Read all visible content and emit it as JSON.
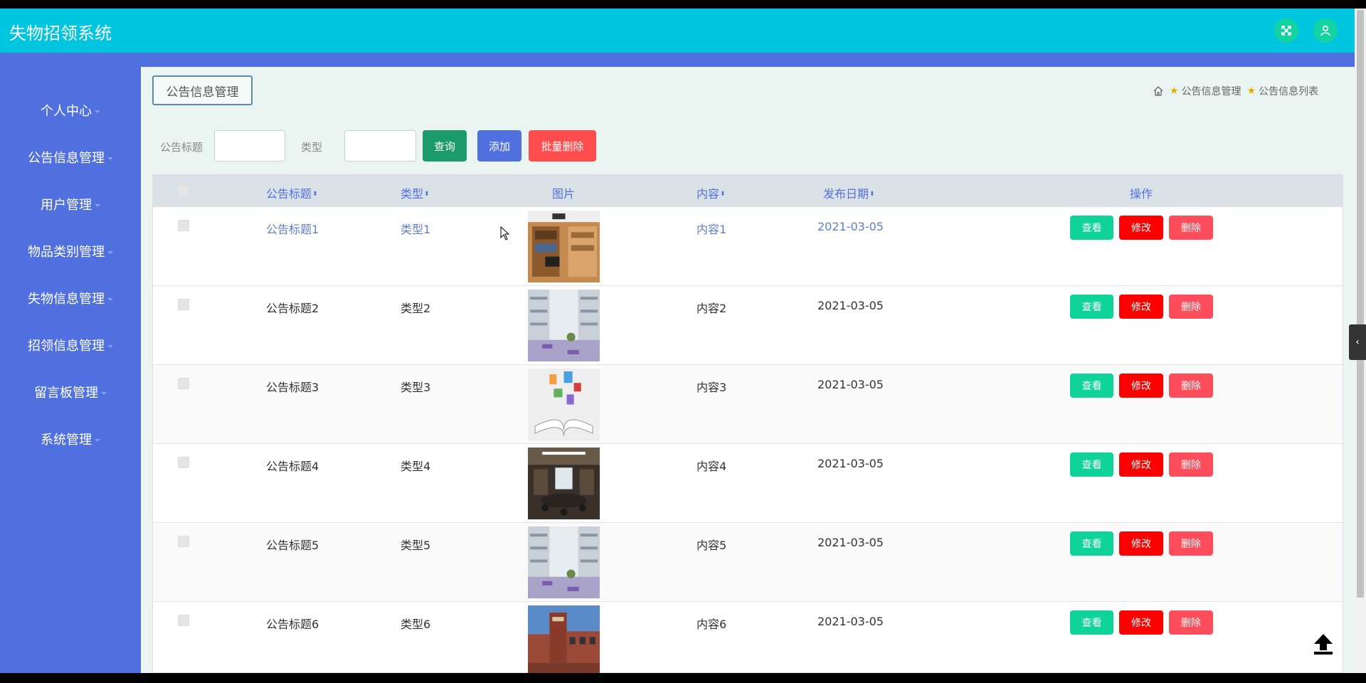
{
  "header": {
    "title": "失物招领系统"
  },
  "sidebar": {
    "items": [
      {
        "label": "个人中心"
      },
      {
        "label": "公告信息管理"
      },
      {
        "label": "用户管理"
      },
      {
        "label": "物品类别管理"
      },
      {
        "label": "失物信息管理"
      },
      {
        "label": "招领信息管理"
      },
      {
        "label": "留言板管理"
      },
      {
        "label": "系统管理"
      }
    ]
  },
  "page": {
    "tag_label": "公告信息管理",
    "breadcrumb": [
      "公告信息管理",
      "公告信息列表"
    ]
  },
  "search": {
    "title_label": "公告标题",
    "type_label": "类型",
    "query_btn": "查询",
    "add_btn": "添加",
    "batch_delete_btn": "批量删除"
  },
  "table": {
    "headers": {
      "title": "公告标题",
      "type": "类型",
      "image": "图片",
      "content": "内容",
      "date": "发布日期",
      "actions": "操作"
    },
    "actions": {
      "view": "查看",
      "edit": "修改",
      "delete": "删除"
    },
    "rows": [
      {
        "title": "公告标题1",
        "type": "类型1",
        "content": "内容1",
        "date": "2021-03-05",
        "image": "study-room-shelves"
      },
      {
        "title": "公告标题2",
        "type": "类型2",
        "content": "内容2",
        "date": "2021-03-05",
        "image": "campus-courtyard"
      },
      {
        "title": "公告标题3",
        "type": "类型3",
        "content": "内容3",
        "date": "2021-03-05",
        "image": "open-book"
      },
      {
        "title": "公告标题4",
        "type": "类型4",
        "content": "内容4",
        "date": "2021-03-05",
        "image": "conference-room"
      },
      {
        "title": "公告标题5",
        "type": "类型5",
        "content": "内容5",
        "date": "2021-03-05",
        "image": "campus-courtyard"
      },
      {
        "title": "公告标题6",
        "type": "类型6",
        "content": "内容6",
        "date": "2021-03-05",
        "image": "brick-building"
      }
    ]
  },
  "colors": {
    "header_bg": "#00c5df",
    "sidebar_bg": "#5170e0",
    "view_btn": "#10d39a",
    "edit_btn": "#ff0000",
    "delete_btn": "#ff4d5b",
    "query_btn": "#1b9b6b",
    "add_btn": "#5170e0",
    "batch_delete_btn": "#ff4d4d"
  },
  "icons": {
    "fullscreen": "expand-arrows-icon",
    "user": "user-icon",
    "home": "home-icon",
    "breadcrumb_sep": "star-icon",
    "back_to_top": "arrow-up-icon",
    "side_toggle": "chevron-left-icon"
  }
}
